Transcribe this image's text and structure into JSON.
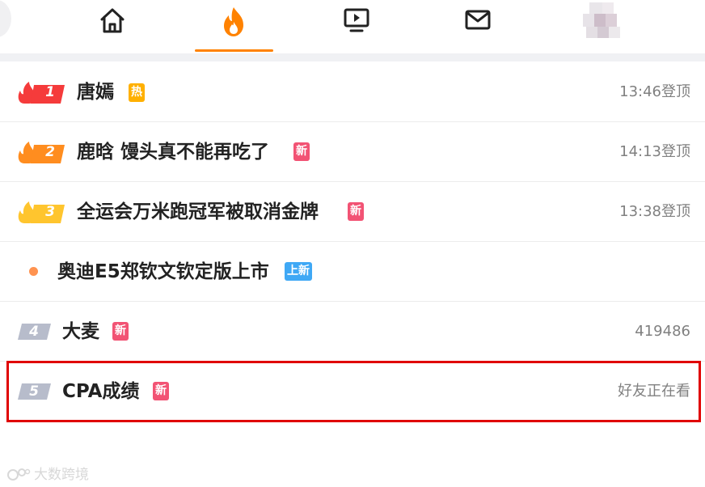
{
  "nav": {
    "items": [
      {
        "name": "home",
        "icon": "home-icon"
      },
      {
        "name": "hot",
        "icon": "fire-icon",
        "active": true
      },
      {
        "name": "video",
        "icon": "video-icon"
      },
      {
        "name": "messages",
        "icon": "mail-icon"
      }
    ],
    "accent": "#ff8200"
  },
  "hot_list": [
    {
      "rank": "1",
      "title": "唐嫣",
      "badge": "热",
      "badge_type": "hot",
      "meta": "13:46登顶"
    },
    {
      "rank": "2",
      "title": "鹿晗 馒头真不能再吃了",
      "badge": "新",
      "badge_type": "new",
      "meta": "14:13登顶"
    },
    {
      "rank": "3",
      "title": "全运会万米跑冠军被取消金牌",
      "badge": "新",
      "badge_type": "new",
      "meta": "13:38登顶"
    },
    {
      "rank": "",
      "title": "奥迪E5郑钦文钦定版上市",
      "badge": "上新",
      "badge_type": "up",
      "meta": ""
    },
    {
      "rank": "4",
      "title": "大麦",
      "badge": "新",
      "badge_type": "new",
      "meta": "419486"
    },
    {
      "rank": "5",
      "title": "CPA成绩",
      "badge": "新",
      "badge_type": "new",
      "meta": "好友正在看"
    }
  ],
  "colors": {
    "rank1": "#f53b3b",
    "rank2": "#ff8d1f",
    "rank3": "#ffc52e",
    "rank_plain": "#b7bccb",
    "badge_hot": "#ffb000",
    "badge_new": "#f25374",
    "badge_up": "#3fa8f5",
    "highlight": "#e00000"
  },
  "watermark": "大数跨境"
}
